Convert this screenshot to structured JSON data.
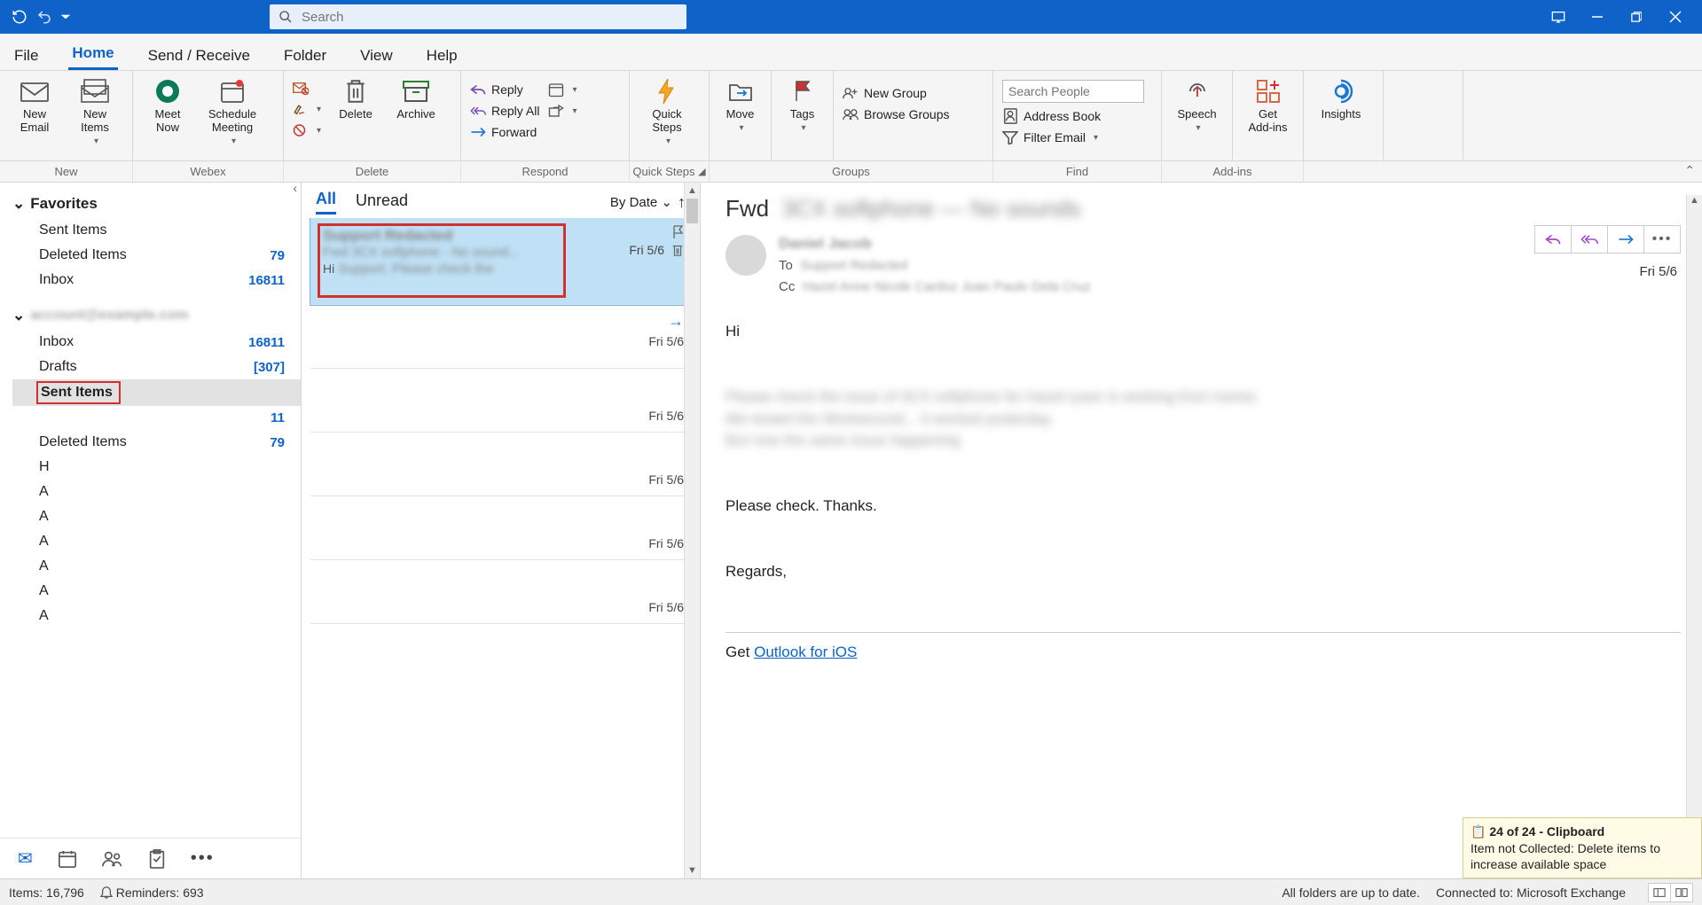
{
  "search": {
    "placeholder": "Search"
  },
  "menu": {
    "file": "File",
    "home": "Home",
    "send_receive": "Send / Receive",
    "folder": "Folder",
    "view": "View",
    "help": "Help"
  },
  "ribbon": {
    "new_email": "New\nEmail",
    "new_items": "New\nItems",
    "meet_now": "Meet\nNow",
    "schedule_meeting": "Schedule\nMeeting",
    "delete": "Delete",
    "archive": "Archive",
    "reply": "Reply",
    "reply_all": "Reply All",
    "forward": "Forward",
    "quick_steps": "Quick\nSteps",
    "move": "Move",
    "tags": "Tags",
    "new_group": "New Group",
    "browse_groups": "Browse Groups",
    "search_people_ph": "Search People",
    "address_book": "Address Book",
    "filter_email": "Filter Email",
    "speech": "Speech",
    "get_addins": "Get\nAdd-ins",
    "insights": "Insights",
    "labels": {
      "new": "New",
      "webex": "Webex",
      "delete": "Delete",
      "respond": "Respond",
      "quick_steps": "Quick Steps",
      "groups": "Groups",
      "find": "Find",
      "addins": "Add-ins"
    }
  },
  "folders": {
    "favorites": "Favorites",
    "fav_items": [
      {
        "name": "Sent Items",
        "count": ""
      },
      {
        "name": "Deleted Items",
        "count": "79"
      },
      {
        "name": "Inbox",
        "count": "16811"
      }
    ],
    "account_items": [
      {
        "name": "Inbox",
        "count": "16811"
      },
      {
        "name": "Drafts",
        "count": "[307]"
      },
      {
        "name": "Sent Items",
        "count": "",
        "selected": true
      },
      {
        "name": "",
        "count": "11"
      },
      {
        "name": "Deleted Items",
        "count": "79"
      },
      {
        "name": "H",
        "count": ""
      },
      {
        "name": "A",
        "count": ""
      },
      {
        "name": "A",
        "count": ""
      },
      {
        "name": "A",
        "count": ""
      },
      {
        "name": "A",
        "count": ""
      },
      {
        "name": "A",
        "count": ""
      },
      {
        "name": "A",
        "count": ""
      }
    ]
  },
  "list": {
    "tab_all": "All",
    "tab_unread": "Unread",
    "sort_label": "By Date",
    "dates": [
      "Fri 5/6",
      "Fri 5/6",
      "Fri 5/6",
      "Fri 5/6",
      "Fri 5/6",
      "Fri 5/6"
    ],
    "preview_prefix": "Hi"
  },
  "reading": {
    "subject_prefix": "Fwd",
    "to_label": "To",
    "cc_label": "Cc",
    "date": "Fri 5/6",
    "body_hi": "Hi",
    "body_line": "Please check. Thanks.",
    "body_regards": "Regards,",
    "body_get": "Get ",
    "body_link": "Outlook for iOS"
  },
  "clipboard": {
    "title": "24 of 24 - Clipboard",
    "msg": "Item not Collected: Delete items to increase available space"
  },
  "status": {
    "items": "Items: 16,796",
    "reminders": "Reminders: 693",
    "folders_uptodate": "All folders are up to date.",
    "connected": "Connected to: Microsoft Exchange"
  }
}
